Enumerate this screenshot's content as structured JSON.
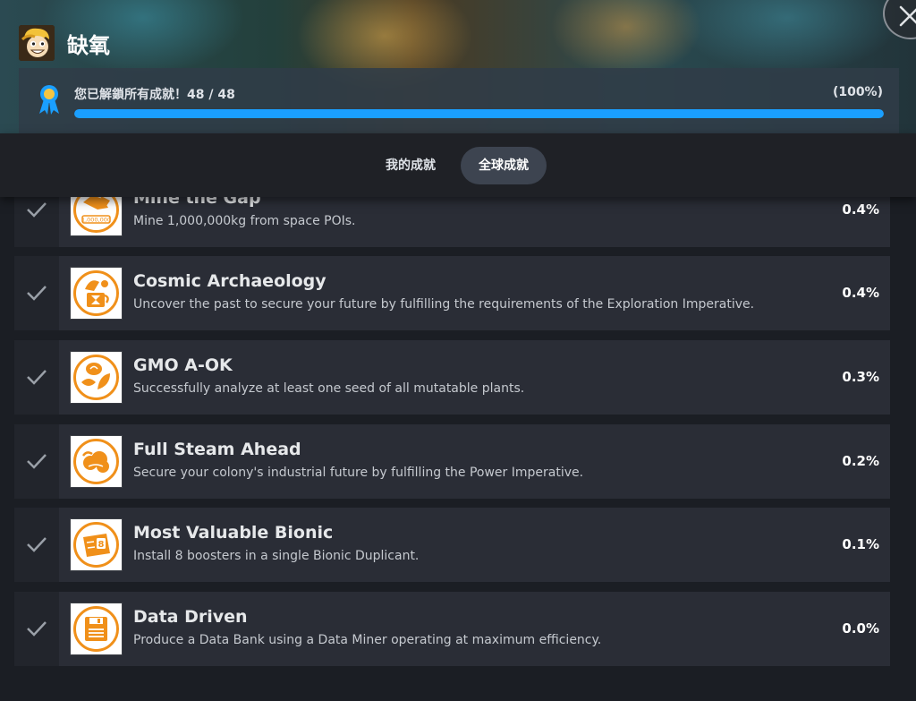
{
  "game": {
    "title": "缺氧"
  },
  "progress": {
    "text": "您已解鎖所有成就！48 / 48",
    "percent_label": "(100%)",
    "fraction": 1.0,
    "bar_color": "#1a9fff"
  },
  "tabs": [
    {
      "label": "我的成就",
      "active": false
    },
    {
      "label": "全球成就",
      "active": true
    }
  ],
  "achievements": [
    {
      "name": "Mine the Gap",
      "description": "Mine 1,000,000kg from space POIs.",
      "percent": "0.4%",
      "icon": "mining-cart-icon",
      "icon_text": "1,000,000",
      "unlocked": true
    },
    {
      "name": "Cosmic Archaeology",
      "description": "Uncover the past to secure your future by fulfilling the requirements of the Exploration Imperative.",
      "percent": "0.4%",
      "icon": "hourglass-artifact-icon",
      "unlocked": true
    },
    {
      "name": "GMO A-OK",
      "description": "Successfully analyze at least one seed of all mutatable plants.",
      "percent": "0.3%",
      "icon": "seed-leaf-icon",
      "unlocked": true
    },
    {
      "name": "Full Steam Ahead",
      "description": "Secure your colony's industrial future by fulfilling the Power Imperative.",
      "percent": "0.2%",
      "icon": "steam-cloud-icon",
      "unlocked": true
    },
    {
      "name": "Most Valuable Bionic",
      "description": "Install 8 boosters in a single Bionic Duplicant.",
      "percent": "0.1%",
      "icon": "booster-pack-icon",
      "icon_text": "8",
      "unlocked": true
    },
    {
      "name": "Data Driven",
      "description": "Produce a Data Bank using a Data Miner operating at maximum efficiency.",
      "percent": "0.0%",
      "icon": "data-disk-icon",
      "unlocked": true
    }
  ],
  "colors": {
    "accent_orange": "#f0901a",
    "row_bg": "#2a2d36",
    "page_bg": "#1b1e24"
  }
}
